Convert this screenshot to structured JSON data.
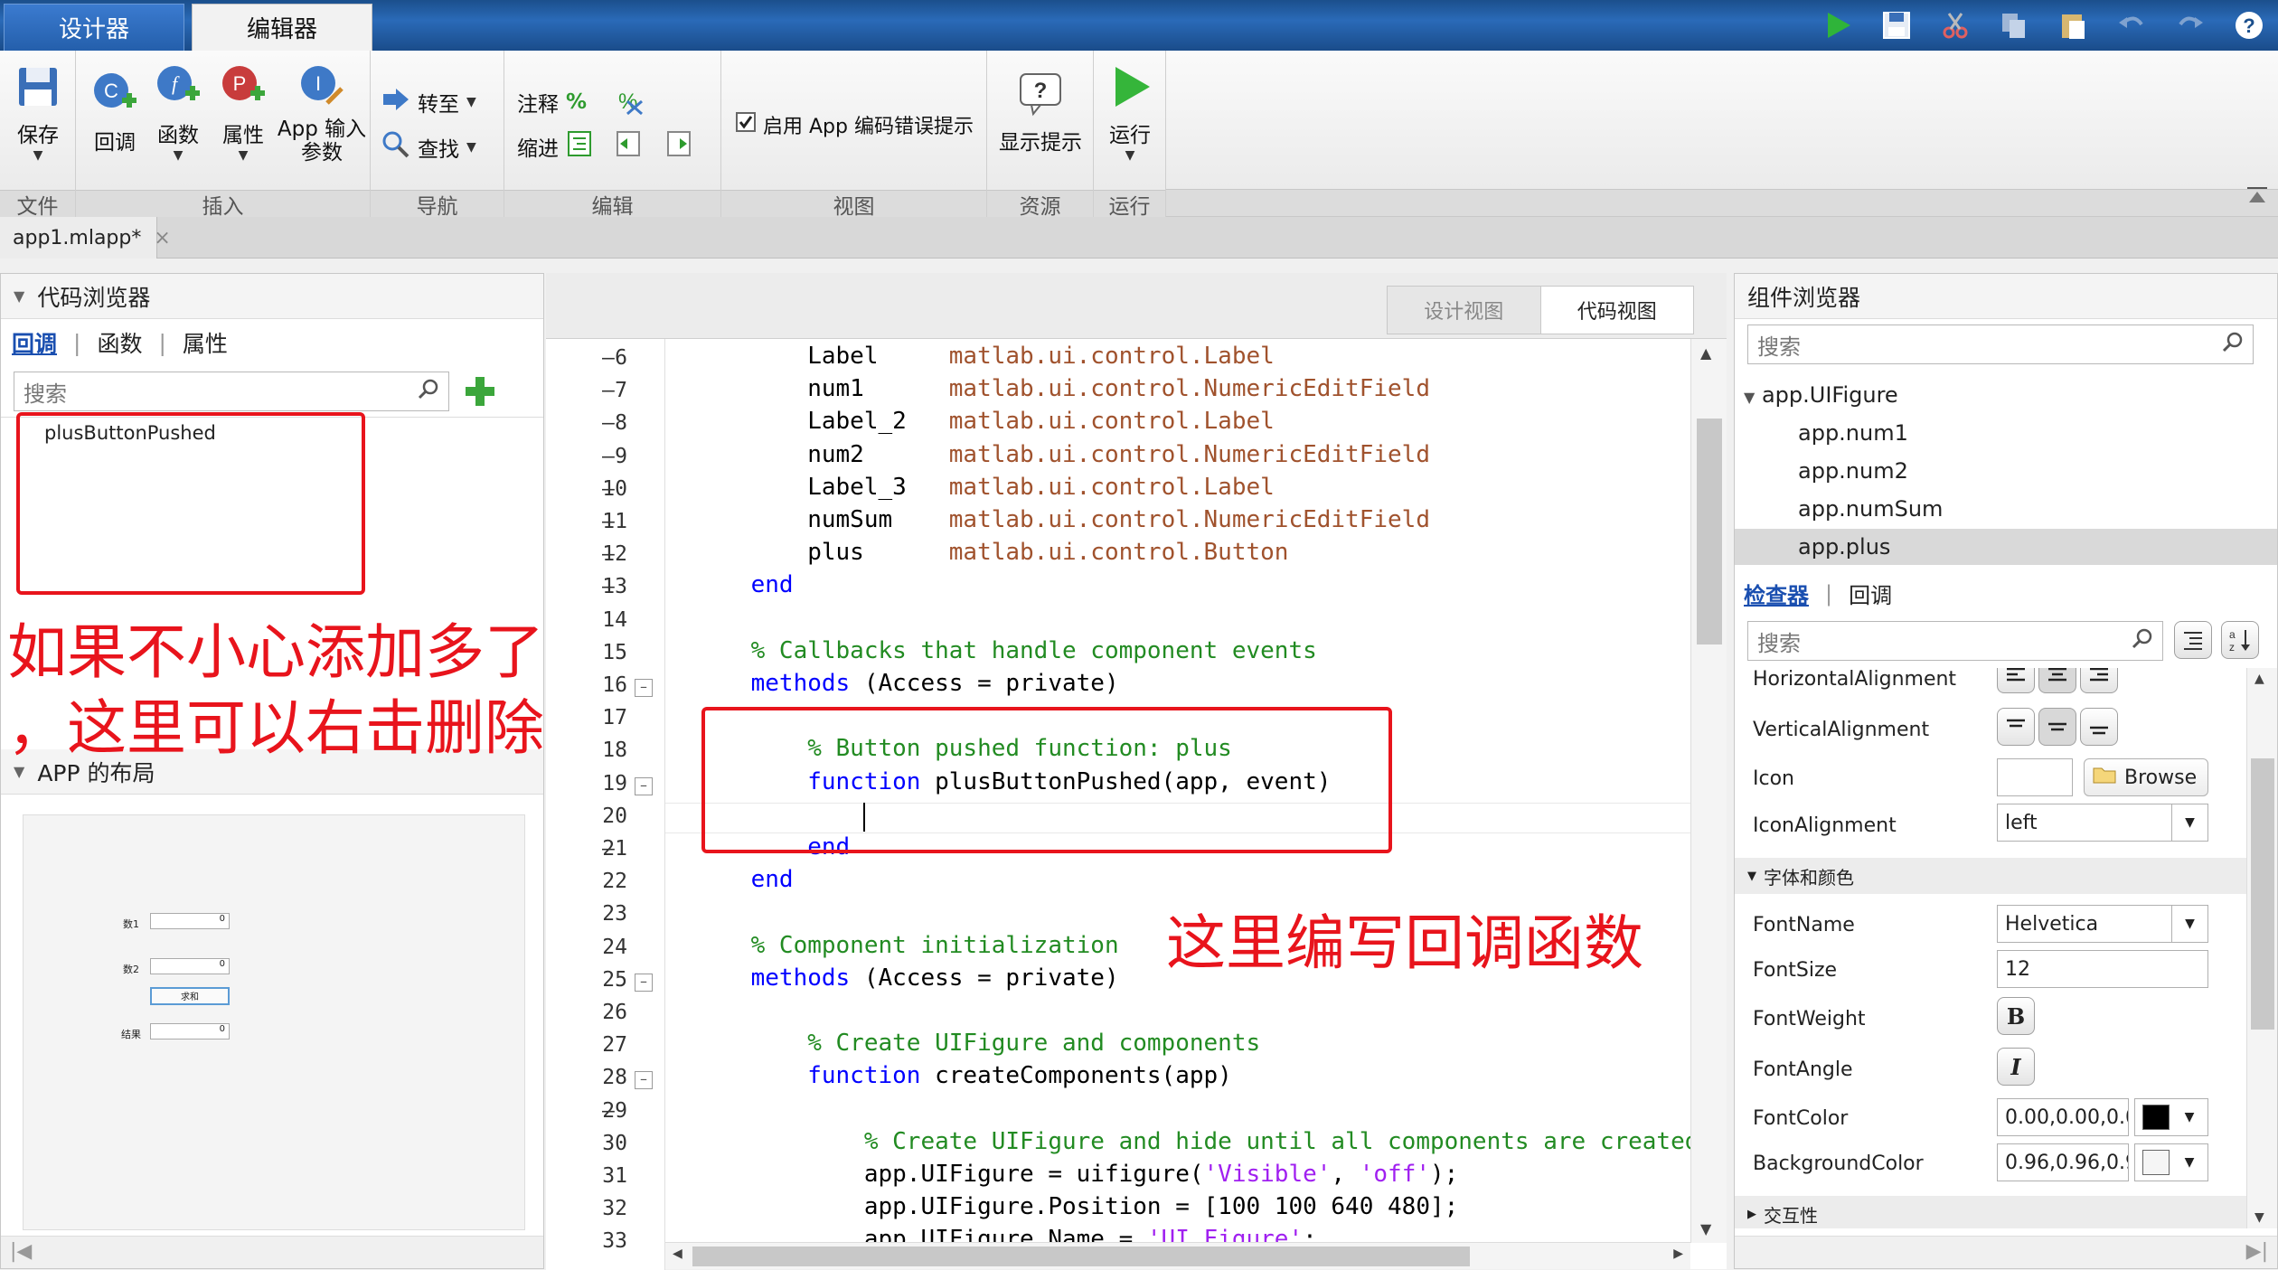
{
  "tabs": {
    "designer": "设计器",
    "editor": "编辑器"
  },
  "quick_icons": [
    "run-icon",
    "save-icon",
    "cut-icon",
    "copy-icon",
    "paste-icon",
    "undo-icon",
    "redo-icon",
    "help-icon"
  ],
  "ribbon": {
    "file": {
      "label": "文件",
      "save": "保存"
    },
    "insert": {
      "label": "插入",
      "callback": "回调",
      "function": "函数",
      "property": "属性",
      "app_input": "App 输入\n参数",
      "callback_badge": "C",
      "function_badge": "f",
      "property_badge": "P",
      "input_badge": "I"
    },
    "navigate": {
      "label": "导航",
      "goto": "转至",
      "find": "查找"
    },
    "edit": {
      "label": "编辑",
      "comment": "注释",
      "indent": "缩进",
      "percent": "%"
    },
    "view": {
      "label": "视图",
      "checkbox": "启用 App 编码错误提示",
      "checked": true
    },
    "resources": {
      "label": "资源",
      "hints": "显示提示"
    },
    "run": {
      "label": "运行",
      "run": "运行"
    }
  },
  "file_tab": {
    "name": "app1.mlapp*",
    "close": "×"
  },
  "left": {
    "code_browser": {
      "title": "代码浏览器",
      "tabs": [
        "回调",
        "函数",
        "属性"
      ],
      "search_placeholder": "搜索",
      "items": [
        "plusButtonPushed"
      ]
    },
    "layout": {
      "title": "APP 的布局",
      "field_labels": [
        "数1",
        "数2",
        "结果"
      ],
      "field_value": "0",
      "button": "求和"
    }
  },
  "editor": {
    "view_toggle": [
      "设计视图",
      "代码视图"
    ],
    "active_view": "代码视图",
    "lines": [
      {
        "n": 6,
        "dash": true,
        "seg": [
          [
            "",
            "        Label     "
          ],
          [
            "ty",
            "matlab.ui.control.Label"
          ]
        ]
      },
      {
        "n": 7,
        "dash": true,
        "seg": [
          [
            "",
            "        num1      "
          ],
          [
            "ty",
            "matlab.ui.control.NumericEditField"
          ]
        ]
      },
      {
        "n": 8,
        "dash": true,
        "seg": [
          [
            "",
            "        Label_2   "
          ],
          [
            "ty",
            "matlab.ui.control.Label"
          ]
        ]
      },
      {
        "n": 9,
        "dash": true,
        "seg": [
          [
            "",
            "        num2      "
          ],
          [
            "ty",
            "matlab.ui.control.NumericEditField"
          ]
        ]
      },
      {
        "n": 10,
        "dash": true,
        "seg": [
          [
            "",
            "        Label_3   "
          ],
          [
            "ty",
            "matlab.ui.control.Label"
          ]
        ]
      },
      {
        "n": 11,
        "dash": true,
        "seg": [
          [
            "",
            "        numSum    "
          ],
          [
            "ty",
            "matlab.ui.control.NumericEditField"
          ]
        ]
      },
      {
        "n": 12,
        "dash": true,
        "seg": [
          [
            "",
            "        plus      "
          ],
          [
            "ty",
            "matlab.ui.control.Button"
          ]
        ]
      },
      {
        "n": 13,
        "dash": true,
        "seg": [
          [
            "kw",
            "    end"
          ]
        ]
      },
      {
        "n": 14,
        "dash": false,
        "seg": []
      },
      {
        "n": 15,
        "dash": false,
        "seg": [
          [
            "cm",
            "    % Callbacks that handle component events"
          ]
        ]
      },
      {
        "n": 16,
        "dash": false,
        "fold": true,
        "seg": [
          [
            "kw",
            "    methods"
          ],
          [
            "",
            " (Access = private)"
          ]
        ]
      },
      {
        "n": 17,
        "dash": false,
        "seg": []
      },
      {
        "n": 18,
        "dash": false,
        "seg": [
          [
            "cm",
            "        % Button pushed function: plus"
          ]
        ]
      },
      {
        "n": 19,
        "dash": false,
        "fold": true,
        "seg": [
          [
            "kw",
            "        function"
          ],
          [
            "",
            " plusButtonPushed(app, event)"
          ]
        ]
      },
      {
        "n": 20,
        "dash": false,
        "seg": [],
        "cursor": true
      },
      {
        "n": 21,
        "dash": true,
        "seg": [
          [
            "kw",
            "        end"
          ]
        ]
      },
      {
        "n": 22,
        "dash": false,
        "seg": [
          [
            "kw",
            "    end"
          ]
        ]
      },
      {
        "n": 23,
        "dash": false,
        "seg": []
      },
      {
        "n": 24,
        "dash": false,
        "seg": [
          [
            "cm",
            "    % Component initialization"
          ]
        ]
      },
      {
        "n": 25,
        "dash": false,
        "fold": true,
        "seg": [
          [
            "kw",
            "    methods"
          ],
          [
            "",
            " (Access = private)"
          ]
        ]
      },
      {
        "n": 26,
        "dash": false,
        "seg": []
      },
      {
        "n": 27,
        "dash": false,
        "seg": [
          [
            "cm",
            "        % Create UIFigure and components"
          ]
        ]
      },
      {
        "n": 28,
        "dash": false,
        "fold": true,
        "seg": [
          [
            "kw",
            "        function"
          ],
          [
            "",
            " createComponents(app)"
          ]
        ]
      },
      {
        "n": 29,
        "dash": true,
        "seg": []
      },
      {
        "n": 30,
        "dash": false,
        "seg": [
          [
            "cm",
            "            % Create UIFigure and hide until all components are created"
          ]
        ]
      },
      {
        "n": 31,
        "dash": false,
        "seg": [
          [
            "",
            "            app.UIFigure = uifigure("
          ],
          [
            "st",
            "'Visible'"
          ],
          [
            "",
            ", "
          ],
          [
            "st",
            "'off'"
          ],
          [
            "",
            ");"
          ]
        ]
      },
      {
        "n": 32,
        "dash": false,
        "seg": [
          [
            "",
            "            app.UIFigure.Position = [100 100 640 480];"
          ]
        ]
      },
      {
        "n": 33,
        "dash": false,
        "seg": [
          [
            "",
            "            app.UIFigure.Name = "
          ],
          [
            "st",
            "'UI Figure'"
          ],
          [
            "",
            ";"
          ]
        ]
      }
    ]
  },
  "right": {
    "component_browser": {
      "title": "组件浏览器",
      "search_placeholder": "搜索",
      "root": "app.UIFigure",
      "children": [
        "app.num1",
        "app.num2",
        "app.numSum",
        "app.plus"
      ],
      "selected": "app.plus"
    },
    "inspector": {
      "tabs": [
        "检查器",
        "回调"
      ],
      "search_placeholder": "搜索",
      "props": {
        "horizontal_alignment": "HorizontalAlignment",
        "vertical_alignment": "VerticalAlignment",
        "icon": "Icon",
        "browse": "Browse",
        "icon_alignment": "IconAlignment",
        "icon_alignment_value": "left",
        "font_section": "字体和颜色",
        "font_name": "FontName",
        "font_name_value": "Helvetica",
        "font_size": "FontSize",
        "font_size_value": "12",
        "font_weight": "FontWeight",
        "font_weight_btn": "B",
        "font_angle": "FontAngle",
        "font_angle_btn": "I",
        "font_color": "FontColor",
        "font_color_value": "0.00,0.00,0.0",
        "background_color": "BackgroundColor",
        "background_color_value": "0.96,0.96,0.9",
        "interactivity_section": "交互性"
      }
    }
  },
  "annotations": {
    "left_note_line1": "如果不小心添加多了",
    "left_note_line2": "，这里可以右击删除",
    "code_note": "这里编写回调函数"
  },
  "colors": {
    "annotation": "#e8141c",
    "keyword": "#0000ff",
    "comment": "#228b22",
    "string": "#a020f0",
    "type": "#a0522d"
  }
}
